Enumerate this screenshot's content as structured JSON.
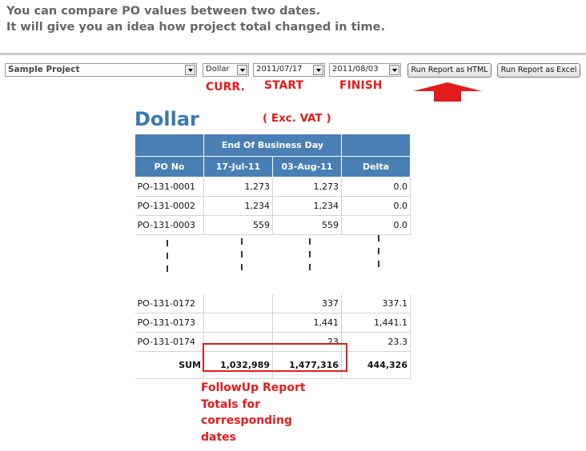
{
  "intro": {
    "line1": "You can compare PO values between two dates.",
    "line2": "It will give you an idea how project total changed in time."
  },
  "controls": {
    "project": "Sample Project",
    "currency": "Dollar",
    "start_date": "2011/07/17",
    "finish_date": "2011/08/03",
    "run_html_label": "Run Report as HTML",
    "run_excel_label": "Run Report as Excel"
  },
  "annotations": {
    "curr": "CURR.",
    "start": "START",
    "finish": "FINISH",
    "vat": "( Exc. VAT )",
    "note_lines": [
      "FollowUp Report",
      "Totals for",
      "corresponding",
      "dates"
    ],
    "accent_color": "#e31b1b"
  },
  "report": {
    "title": "Dollar",
    "header_group": "End Of Business Day",
    "columns": [
      "PO No",
      "17-Jul-11",
      "03-Aug-11",
      "Delta"
    ],
    "rows_top": [
      [
        "PO-131-0001",
        "1,273",
        "1,273",
        "0.0"
      ],
      [
        "PO-131-0002",
        "1,234",
        "1,234",
        "0.0"
      ],
      [
        "PO-131-0003",
        "559",
        "559",
        "0.0"
      ]
    ],
    "rows_bottom": [
      [
        "PO-131-0172",
        "",
        "337",
        "337.1"
      ],
      [
        "PO-131-0173",
        "",
        "1,441",
        "1,441.1"
      ],
      [
        "PO-131-0174",
        "",
        "23",
        "23.3"
      ]
    ],
    "sum": [
      "SUM",
      "1,032,989",
      "1,477,316",
      "444,326"
    ],
    "header_color": "#4a7fb5"
  }
}
